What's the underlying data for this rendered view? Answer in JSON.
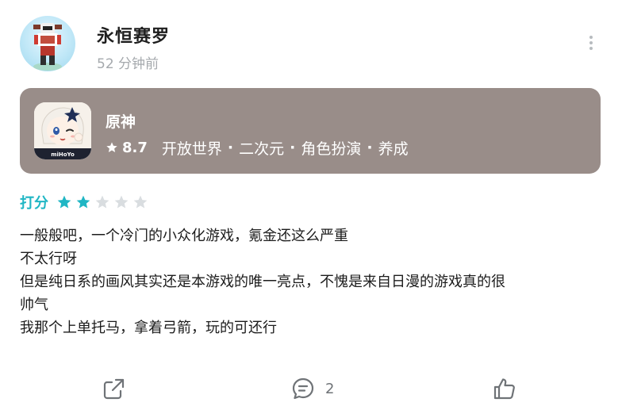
{
  "post": {
    "username": "永恒赛罗",
    "timestamp": "52 分钟前",
    "more_icon": "more-vertical-icon"
  },
  "game": {
    "title": "原神",
    "score": "8.7",
    "tags": [
      "开放世界",
      "二次元",
      "角色扮演",
      "养成"
    ],
    "tag_separator": "·",
    "icon_logo_text": "miHoYo",
    "card_color": "#998d89"
  },
  "rating": {
    "label": "打分",
    "value": 2,
    "max": 5,
    "active_color": "#1fb6c4",
    "inactive_color": "#d9dde0"
  },
  "review": {
    "lines": [
      "一般般吧，一个冷门的小众化游戏，氪金还这么严重",
      "不太行呀",
      "但是纯日系的画风其实还是本游戏的唯一亮点，不愧是来自日漫的游戏真的很",
      "帅气",
      "我那个上单托马，拿着弓箭，玩的可还行"
    ]
  },
  "actions": {
    "share_icon": "share-icon",
    "comment_icon": "comment-icon",
    "comment_count": "2",
    "like_icon": "thumbs-up-icon"
  }
}
